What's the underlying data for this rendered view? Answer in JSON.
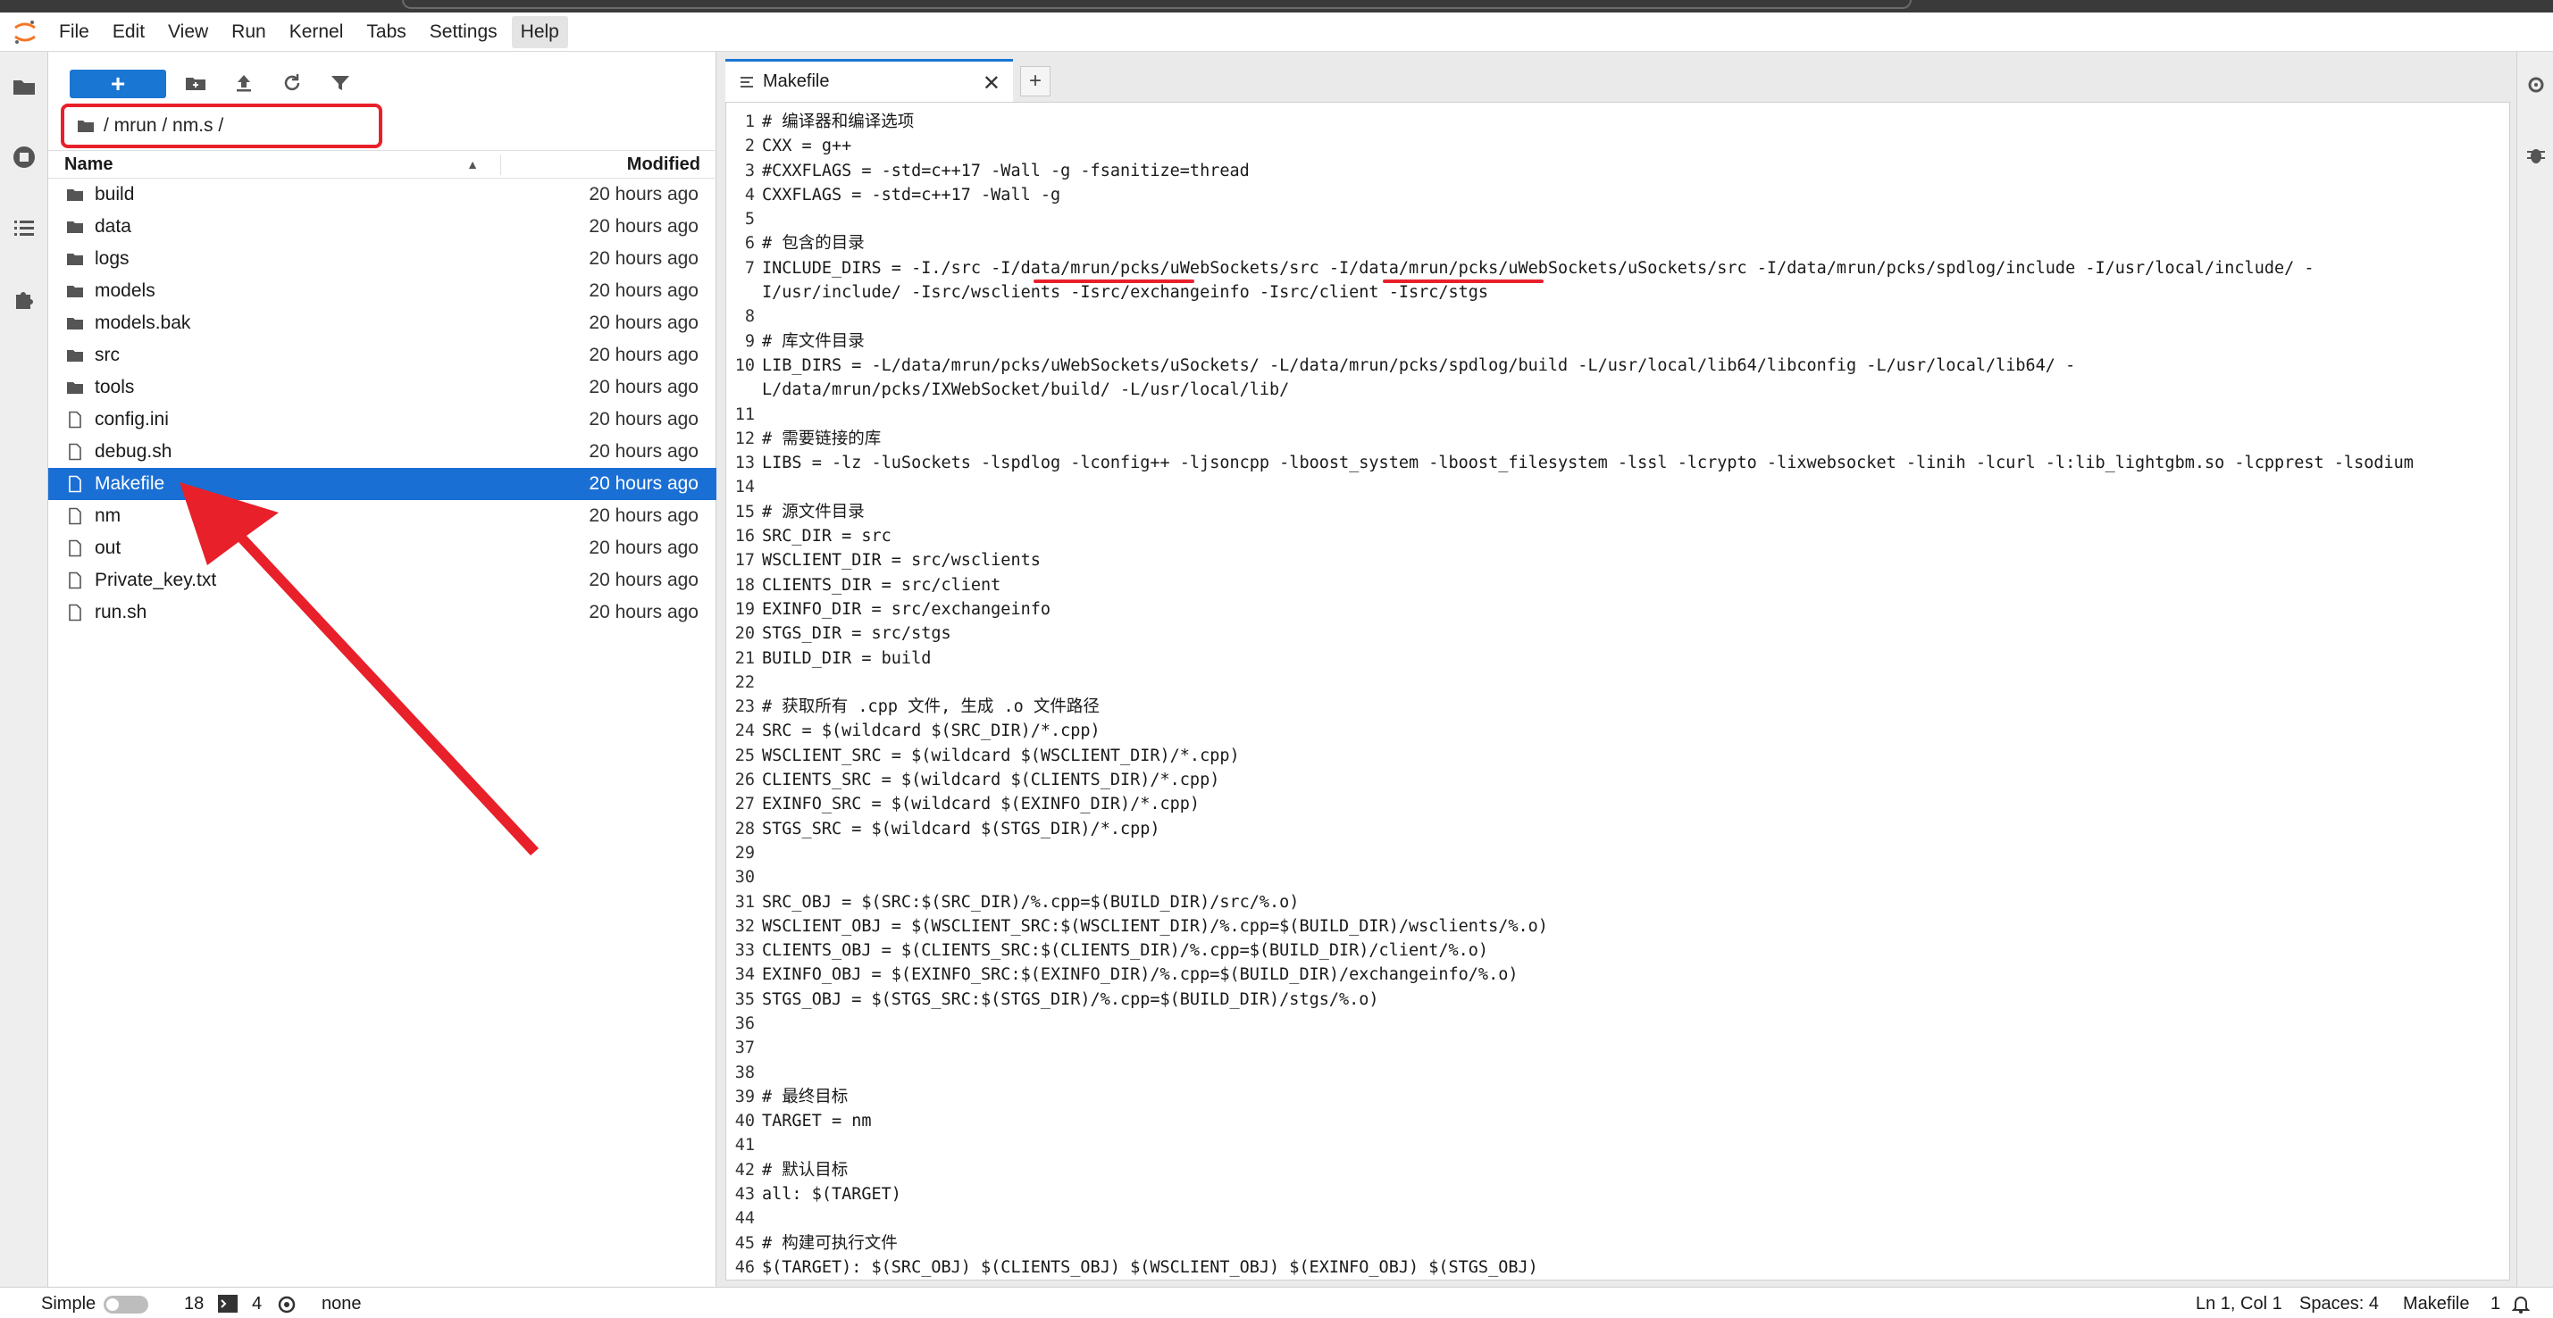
{
  "menu": {
    "items": [
      "File",
      "Edit",
      "View",
      "Run",
      "Kernel",
      "Tabs",
      "Settings",
      "Help"
    ],
    "active": "Help"
  },
  "filebrowser": {
    "new_label": "+",
    "breadcrumb": "/ mrun / nm.s /",
    "header": {
      "name": "Name",
      "modified": "Modified"
    },
    "files": [
      {
        "name": "build",
        "modified": "20 hours ago",
        "type": "folder"
      },
      {
        "name": "data",
        "modified": "20 hours ago",
        "type": "folder"
      },
      {
        "name": "logs",
        "modified": "20 hours ago",
        "type": "folder"
      },
      {
        "name": "models",
        "modified": "20 hours ago",
        "type": "folder"
      },
      {
        "name": "models.bak",
        "modified": "20 hours ago",
        "type": "folder"
      },
      {
        "name": "src",
        "modified": "20 hours ago",
        "type": "folder"
      },
      {
        "name": "tools",
        "modified": "20 hours ago",
        "type": "folder"
      },
      {
        "name": "config.ini",
        "modified": "20 hours ago",
        "type": "file"
      },
      {
        "name": "debug.sh",
        "modified": "20 hours ago",
        "type": "file"
      },
      {
        "name": "Makefile",
        "modified": "20 hours ago",
        "type": "file",
        "selected": true
      },
      {
        "name": "nm",
        "modified": "20 hours ago",
        "type": "file"
      },
      {
        "name": "out",
        "modified": "20 hours ago",
        "type": "file"
      },
      {
        "name": "Private_key.txt",
        "modified": "20 hours ago",
        "type": "file"
      },
      {
        "name": "run.sh",
        "modified": "20 hours ago",
        "type": "file"
      }
    ]
  },
  "editor": {
    "tab_title": "Makefile",
    "tab_close": "✕",
    "add_tab": "+",
    "lines": [
      {
        "n": "1",
        "t": "# 编译器和编译选项"
      },
      {
        "n": "2",
        "t": "CXX = g++"
      },
      {
        "n": "3",
        "t": "#CXXFLAGS = -std=c++17 -Wall -g -fsanitize=thread"
      },
      {
        "n": "4",
        "t": "CXXFLAGS = -std=c++17 -Wall -g"
      },
      {
        "n": "5",
        "t": ""
      },
      {
        "n": "6",
        "t": "# 包含的目录"
      },
      {
        "n": "7",
        "t": "INCLUDE_DIRS = -I./src -I/data/mrun/pcks/uWebSockets/src -I/data/mrun/pcks/uWebSockets/uSockets/src -I/data/mrun/pcks/spdlog/include -I/usr/local/include/ -"
      },
      {
        "n": "",
        "t": "I/usr/include/ -Isrc/wsclients -Isrc/exchangeinfo -Isrc/client -Isrc/stgs"
      },
      {
        "n": "8",
        "t": ""
      },
      {
        "n": "9",
        "t": "# 库文件目录"
      },
      {
        "n": "10",
        "t": "LIB_DIRS = -L/data/mrun/pcks/uWebSockets/uSockets/ -L/data/mrun/pcks/spdlog/build -L/usr/local/lib64/libconfig -L/usr/local/lib64/ -"
      },
      {
        "n": "",
        "t": "L/data/mrun/pcks/IXWebSocket/build/ -L/usr/local/lib/"
      },
      {
        "n": "11",
        "t": ""
      },
      {
        "n": "12",
        "t": "# 需要链接的库"
      },
      {
        "n": "13",
        "t": "LIBS = -lz -luSockets -lspdlog -lconfig++ -ljsoncpp -lboost_system -lboost_filesystem -lssl -lcrypto -lixwebsocket -linih -lcurl -l:lib_lightgbm.so -lcpprest -lsodium"
      },
      {
        "n": "14",
        "t": ""
      },
      {
        "n": "15",
        "t": "# 源文件目录"
      },
      {
        "n": "16",
        "t": "SRC_DIR = src"
      },
      {
        "n": "17",
        "t": "WSCLIENT_DIR = src/wsclients"
      },
      {
        "n": "18",
        "t": "CLIENTS_DIR = src/client"
      },
      {
        "n": "19",
        "t": "EXINFO_DIR = src/exchangeinfo"
      },
      {
        "n": "20",
        "t": "STGS_DIR = src/stgs"
      },
      {
        "n": "21",
        "t": "BUILD_DIR = build"
      },
      {
        "n": "22",
        "t": ""
      },
      {
        "n": "23",
        "t": "# 获取所有 .cpp 文件, 生成 .o 文件路径"
      },
      {
        "n": "24",
        "t": "SRC = $(wildcard $(SRC_DIR)/*.cpp)"
      },
      {
        "n": "25",
        "t": "WSCLIENT_SRC = $(wildcard $(WSCLIENT_DIR)/*.cpp)"
      },
      {
        "n": "26",
        "t": "CLIENTS_SRC = $(wildcard $(CLIENTS_DIR)/*.cpp)"
      },
      {
        "n": "27",
        "t": "EXINFO_SRC = $(wildcard $(EXINFO_DIR)/*.cpp)"
      },
      {
        "n": "28",
        "t": "STGS_SRC = $(wildcard $(STGS_DIR)/*.cpp)"
      },
      {
        "n": "29",
        "t": ""
      },
      {
        "n": "30",
        "t": ""
      },
      {
        "n": "31",
        "t": "SRC_OBJ = $(SRC:$(SRC_DIR)/%.cpp=$(BUILD_DIR)/src/%.o)"
      },
      {
        "n": "32",
        "t": "WSCLIENT_OBJ = $(WSCLIENT_SRC:$(WSCLIENT_DIR)/%.cpp=$(BUILD_DIR)/wsclients/%.o)"
      },
      {
        "n": "33",
        "t": "CLIENTS_OBJ = $(CLIENTS_SRC:$(CLIENTS_DIR)/%.cpp=$(BUILD_DIR)/client/%.o)"
      },
      {
        "n": "34",
        "t": "EXINFO_OBJ = $(EXINFO_SRC:$(EXINFO_DIR)/%.cpp=$(BUILD_DIR)/exchangeinfo/%.o)"
      },
      {
        "n": "35",
        "t": "STGS_OBJ = $(STGS_SRC:$(STGS_DIR)/%.cpp=$(BUILD_DIR)/stgs/%.o)"
      },
      {
        "n": "36",
        "t": ""
      },
      {
        "n": "37",
        "t": ""
      },
      {
        "n": "38",
        "t": ""
      },
      {
        "n": "39",
        "t": "# 最终目标"
      },
      {
        "n": "40",
        "t": "TARGET = nm"
      },
      {
        "n": "41",
        "t": ""
      },
      {
        "n": "42",
        "t": "# 默认目标"
      },
      {
        "n": "43",
        "t": "all: $(TARGET)"
      },
      {
        "n": "44",
        "t": ""
      },
      {
        "n": "45",
        "t": "# 构建可执行文件"
      },
      {
        "n": "46",
        "t": "$(TARGET): $(SRC_OBJ) $(CLIENTS_OBJ) $(WSCLIENT_OBJ) $(EXINFO_OBJ) $(STGS_OBJ)"
      }
    ]
  },
  "statusbar": {
    "mode": "Simple",
    "terminals": "18",
    "kernels": "4",
    "kernel_name": "none",
    "cursor": "Ln 1, Col 1",
    "spaces": "Spaces: 4",
    "file_type": "Makefile",
    "notifications": "1"
  },
  "colors": {
    "accent": "#1976d2",
    "selected_row": "#1a6fd4",
    "annotation_red": "#e8202a"
  },
  "icons": {
    "leftbar": [
      "folder-icon",
      "stop-circle-icon",
      "list-icon",
      "puzzle-icon"
    ],
    "toolbar": [
      "new-folder-icon",
      "upload-icon",
      "refresh-icon",
      "filter-icon"
    ],
    "rightbar": [
      "property-inspector-icon",
      "debugger-icon"
    ]
  }
}
